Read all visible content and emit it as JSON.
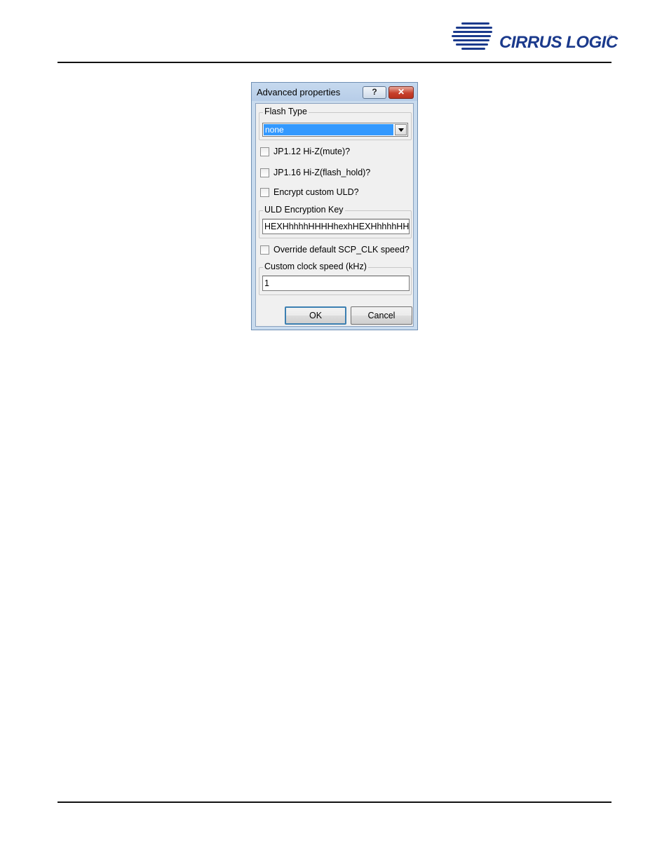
{
  "header": {
    "logo_text": "CIRRUS LOGIC",
    "logo_mark": "®",
    "brand_color": "#1b3a8c"
  },
  "dialog": {
    "title": "Advanced properties",
    "help_button_glyph": "?",
    "close_button_glyph": "✕",
    "flash_type": {
      "label": "Flash Type",
      "selected_value": "none"
    },
    "checkboxes": [
      {
        "label": "JP1.12 Hi-Z(mute)?",
        "checked": false
      },
      {
        "label": "JP1.16 Hi-Z(flash_hold)?",
        "checked": false
      },
      {
        "label": "Encrypt custom ULD?",
        "checked": false
      }
    ],
    "uld_key": {
      "label": "ULD Encryption Key",
      "value": "HEXHhhhhHHHHhexhHEXHhhhhHHHH"
    },
    "override_clock": {
      "label": "Override default SCP_CLK speed?",
      "checked": false
    },
    "custom_clock": {
      "label": "Custom clock speed (kHz)",
      "value": "1"
    },
    "ok_label": "OK",
    "cancel_label": "Cancel"
  }
}
